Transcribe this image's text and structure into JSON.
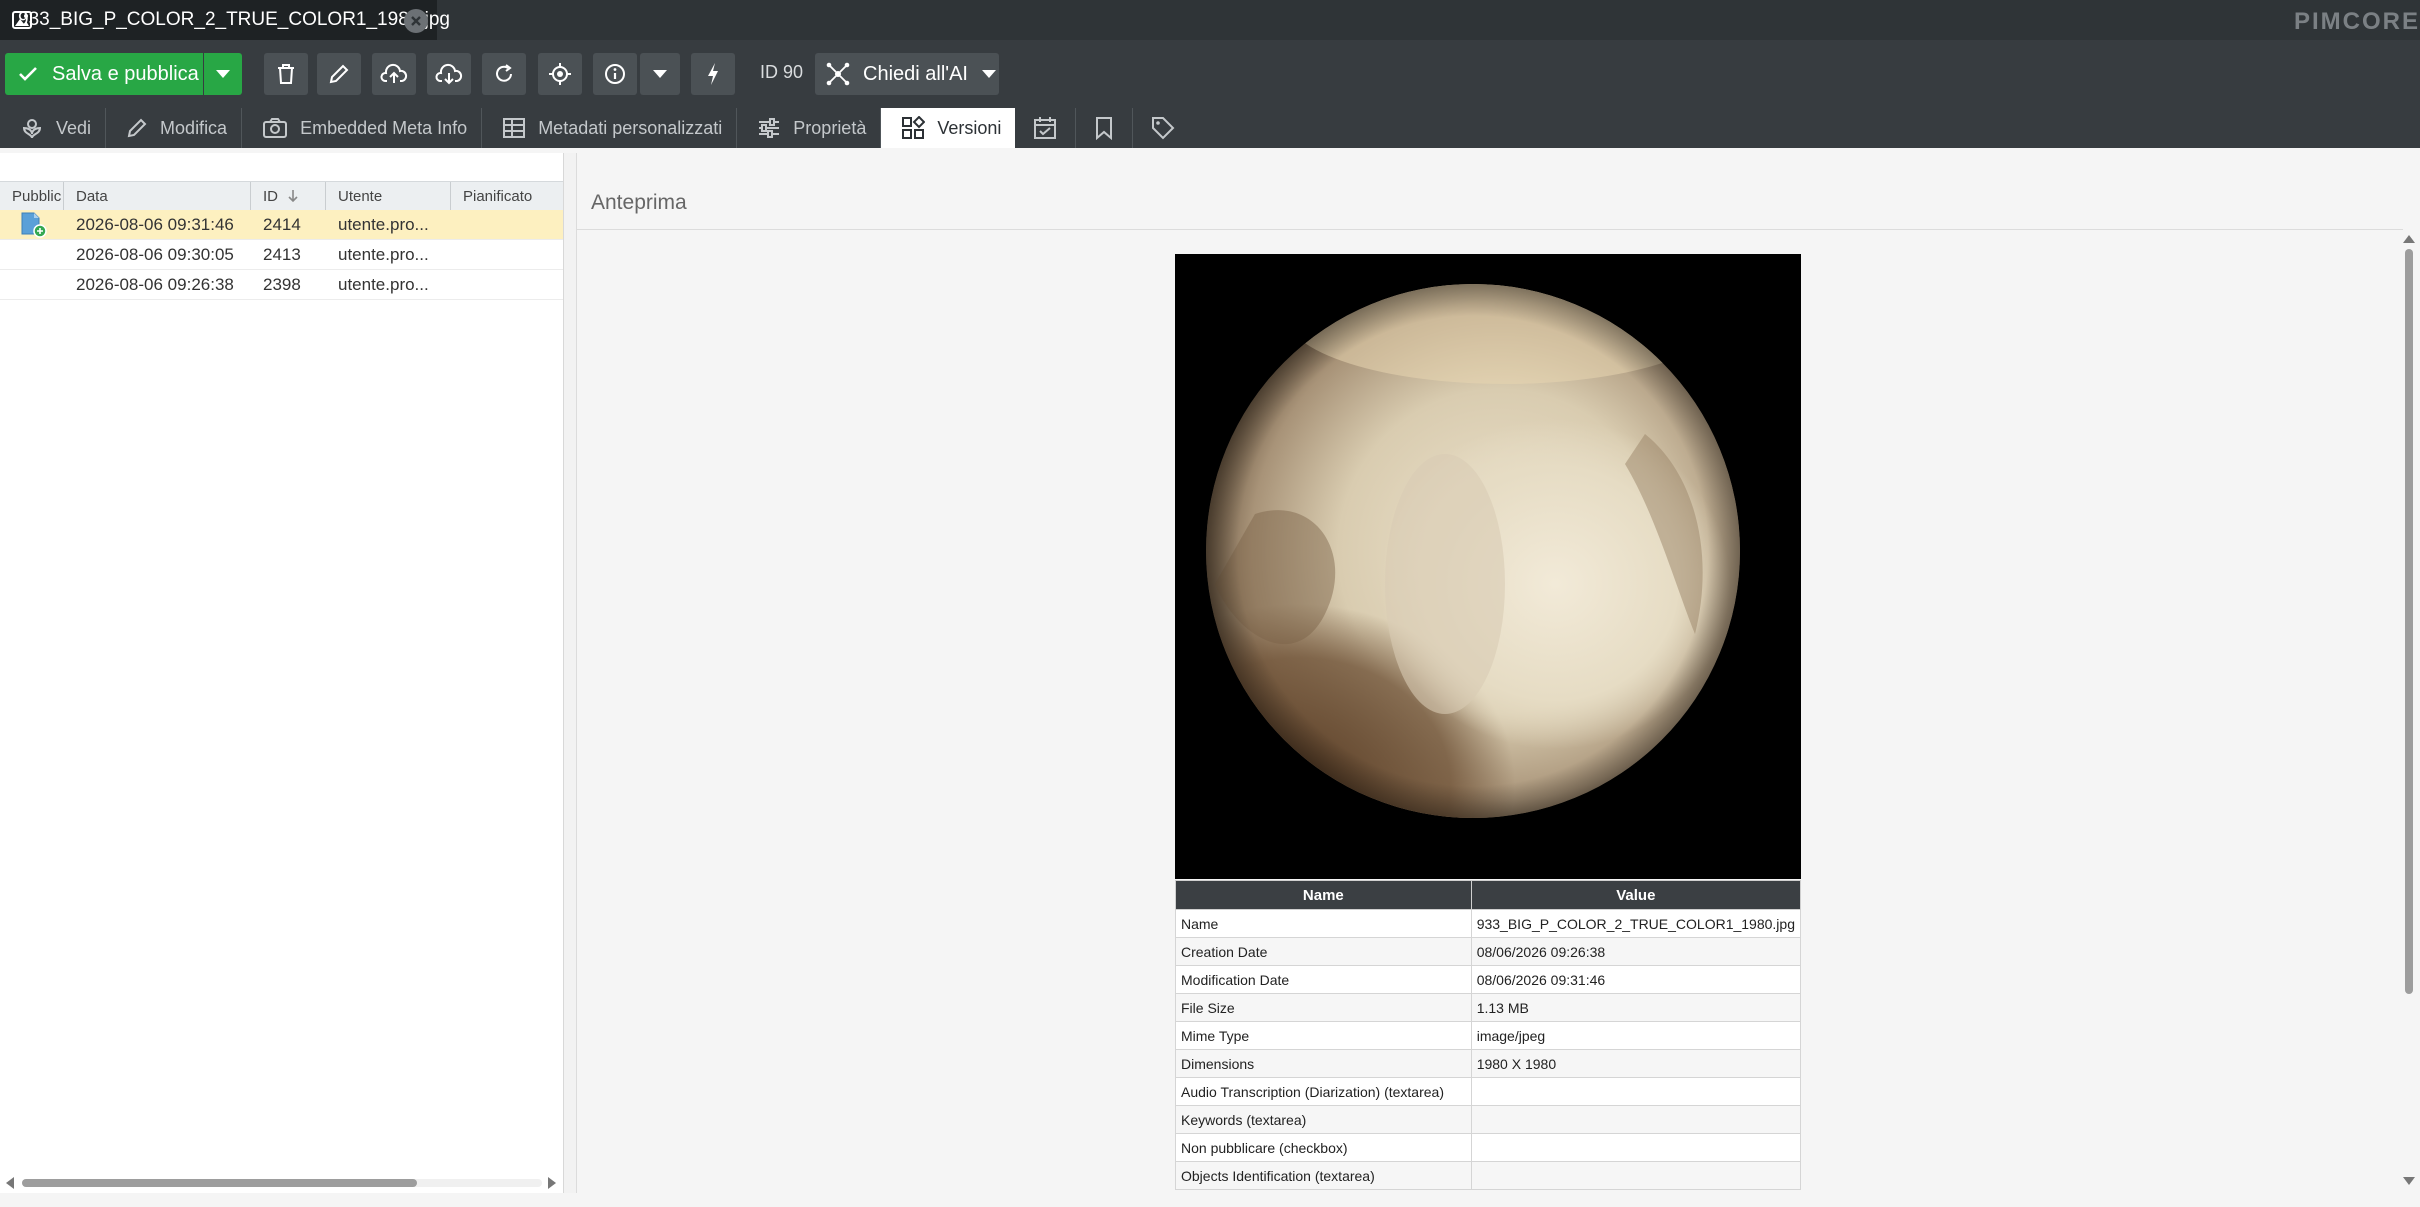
{
  "tab": {
    "title": "933_BIG_P_COLOR_2_TRUE_COLOR1_1980.jpg"
  },
  "brand": "PIMCORE",
  "toolbar": {
    "save_label": "Salva e pubblica",
    "id_label": "ID 90",
    "ai_label": "Chiedi all'AI"
  },
  "subtabs": [
    {
      "label": "Vedi"
    },
    {
      "label": "Modifica"
    },
    {
      "label": "Embedded Meta Info"
    },
    {
      "label": "Metadati personalizzati"
    },
    {
      "label": "Proprietà"
    },
    {
      "label": "Versioni"
    }
  ],
  "versions": {
    "columns": [
      "Pubblic",
      "Data",
      "ID",
      "Utente",
      "Pianificato"
    ],
    "rows": [
      {
        "date": "2026-08-06 09:31:46",
        "id": "2414",
        "user": "utente.pro...",
        "scheduled": "",
        "published": true
      },
      {
        "date": "2026-08-06 09:30:05",
        "id": "2413",
        "user": "utente.pro...",
        "scheduled": "",
        "published": false
      },
      {
        "date": "2026-08-06 09:26:38",
        "id": "2398",
        "user": "utente.pro...",
        "scheduled": "",
        "published": false
      }
    ]
  },
  "preview": {
    "title": "Anteprima",
    "table_headers": [
      "Name",
      "Value"
    ],
    "metadata": [
      {
        "name": "Name",
        "value": "933_BIG_P_COLOR_2_TRUE_COLOR1_1980.jpg"
      },
      {
        "name": "Creation Date",
        "value": "08/06/2026 09:26:38"
      },
      {
        "name": "Modification Date",
        "value": "08/06/2026 09:31:46"
      },
      {
        "name": "File Size",
        "value": "1.13 MB"
      },
      {
        "name": "Mime Type",
        "value": "image/jpeg"
      },
      {
        "name": "Dimensions",
        "value": "1980 X 1980"
      },
      {
        "name": "Audio Transcription (Diarization) (textarea)",
        "value": ""
      },
      {
        "name": "Keywords (textarea)",
        "value": ""
      },
      {
        "name": "Non pubblicare (checkbox)",
        "value": ""
      },
      {
        "name": "Objects Identification (textarea)",
        "value": ""
      }
    ]
  },
  "colors": {
    "accent": "#28a745",
    "toolbar": "#373c40",
    "tabbar": "#2f3437",
    "selected_row": "#fdf0c0"
  }
}
